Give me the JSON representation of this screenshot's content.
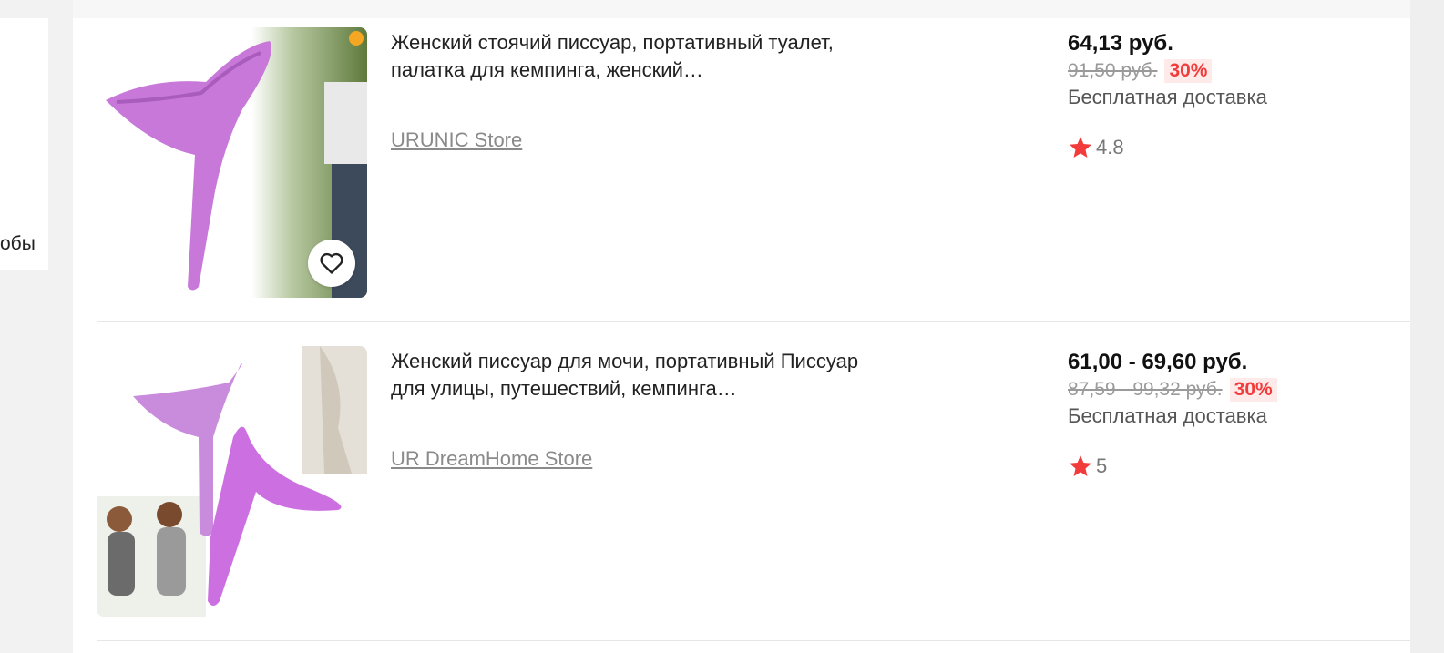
{
  "sidebar": {
    "cut_text": "обы"
  },
  "colors": {
    "accent_red": "#f23b3b",
    "discount_bg": "#ffeaea",
    "product_purple": "#c778d8"
  },
  "products": [
    {
      "title": "Женский стоячий писсуар, портативный туалет, палатка для кемпинга, женский…",
      "store": "URUNIC Store",
      "price": "64,13 руб.",
      "old_price": "91,50 руб.",
      "discount": "30%",
      "delivery": "Бесплатная доставка",
      "rating": "4.8",
      "icons": [
        "heart-icon",
        "star-icon"
      ]
    },
    {
      "title": "Женский писсуар для мочи, портативный Писсуар для улицы, путешествий, кемпинга…",
      "store": "UR DreamHome Store",
      "price": "61,00 - 69,60 руб.",
      "old_price": "87,59 - 99,32 руб.",
      "discount": "30%",
      "delivery": "Бесплатная доставка",
      "rating": "5",
      "icons": [
        "star-icon"
      ]
    }
  ]
}
